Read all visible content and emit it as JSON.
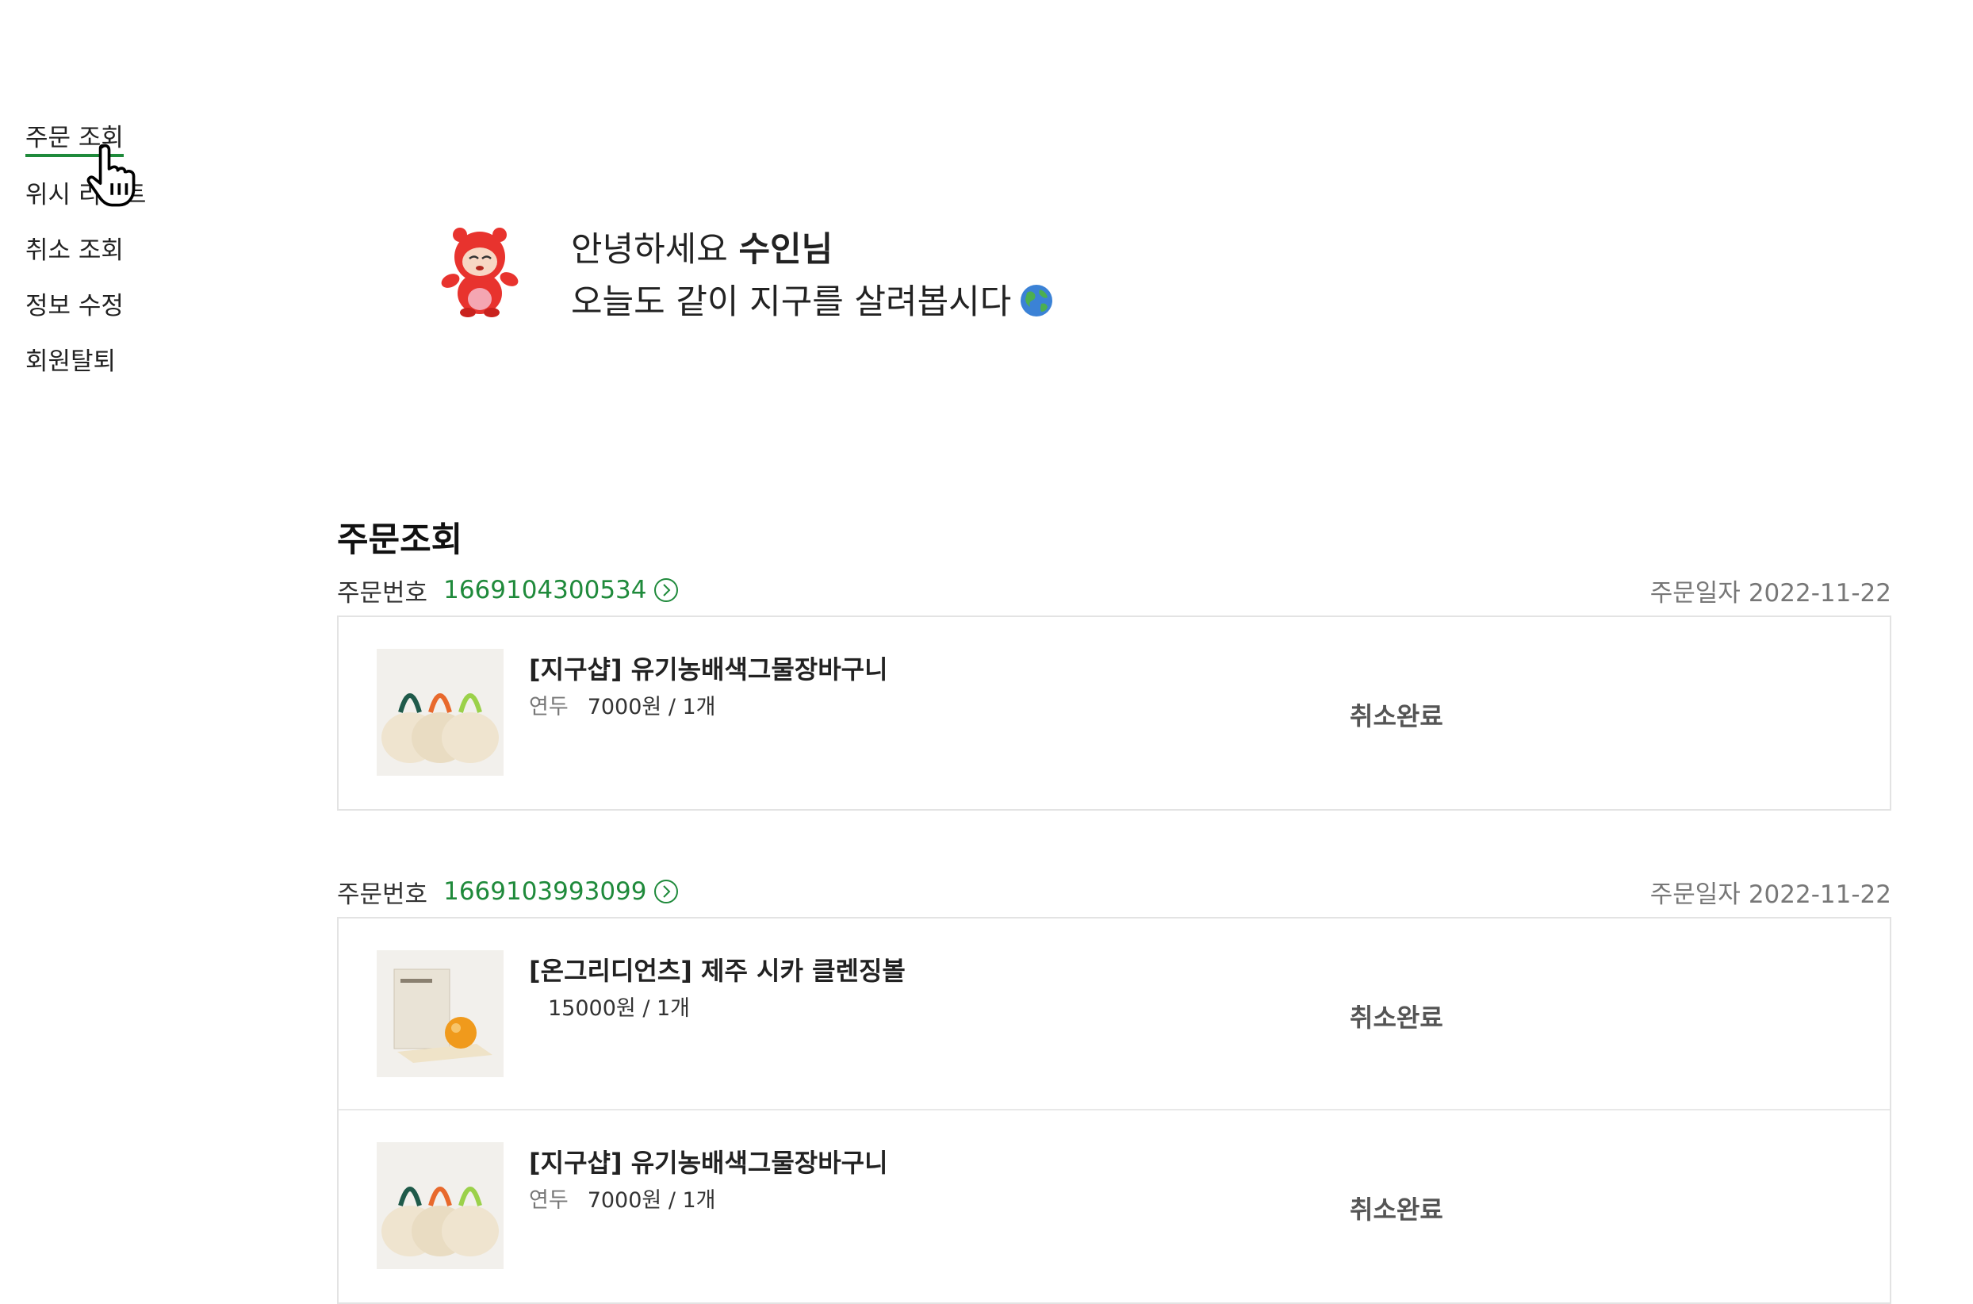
{
  "sidebar": {
    "items": [
      {
        "label": "주문 조회",
        "active": true
      },
      {
        "label": "위시 리스트",
        "active": false
      },
      {
        "label": "취소 조회",
        "active": false
      },
      {
        "label": "정보 수정",
        "active": false
      },
      {
        "label": "회원탈퇴",
        "active": false
      }
    ]
  },
  "greeting": {
    "hello": "안녕하세요",
    "name": "수인님",
    "line2": "오늘도 같이 지구를 살려봅시다"
  },
  "section": {
    "title": "주문조회"
  },
  "labels": {
    "order_no": "주문번호",
    "order_date": "주문일자"
  },
  "orders": [
    {
      "number": "1669104300534",
      "date": "2022-11-22",
      "items": [
        {
          "name": "[지구샵] 유기농배색그물장바구니",
          "option": "연두",
          "price_qty": "7000원 / 1개",
          "status": "취소완료",
          "image": "mesh-bag"
        }
      ]
    },
    {
      "number": "1669103993099",
      "date": "2022-11-22",
      "items": [
        {
          "name": "[온그리디언츠] 제주 시카 클렌징볼",
          "option": "",
          "price_qty": "15000원 / 1개",
          "status": "취소완료",
          "image": "cleansing-ball"
        },
        {
          "name": "[지구샵] 유기농배색그물장바구니",
          "option": "연두",
          "price_qty": "7000원 / 1개",
          "status": "취소완료",
          "image": "mesh-bag"
        }
      ]
    }
  ],
  "colors": {
    "accent": "#1f8a3b",
    "status": "#555555",
    "border": "#e3e3e3"
  }
}
